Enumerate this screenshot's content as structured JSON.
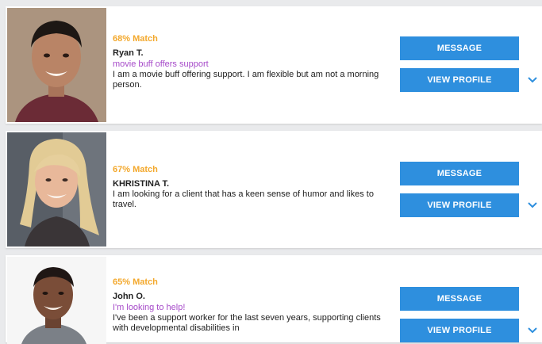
{
  "theme": {
    "accent": "#2e8fde",
    "match_color": "#f3a82c",
    "tagline_color": "#a64ac9",
    "bg": "#e9eaec"
  },
  "profiles": [
    {
      "match": "68% Match",
      "name": "Ryan T.",
      "tagline": "movie buff offers support",
      "bio": "I am a movie buff offering support. I am flexible but am not a morning person.",
      "message_label": "MESSAGE",
      "view_label": "VIEW PROFILE",
      "expand_icon": "chevron-down-icon"
    },
    {
      "match": "67% Match",
      "name": "KHRISTINA T.",
      "tagline": "",
      "bio": "I am looking for a client that has a keen sense of humor and likes to travel.",
      "message_label": "MESSAGE",
      "view_label": "VIEW PROFILE",
      "expand_icon": "chevron-down-icon"
    },
    {
      "match": "65% Match",
      "name": "John O.",
      "tagline": "I'm looking to help!",
      "bio": "I've been a support worker for the last seven years, supporting clients with developmental disabilities in",
      "message_label": "MESSAGE",
      "view_label": "VIEW PROFILE",
      "expand_icon": "chevron-down-icon"
    }
  ]
}
